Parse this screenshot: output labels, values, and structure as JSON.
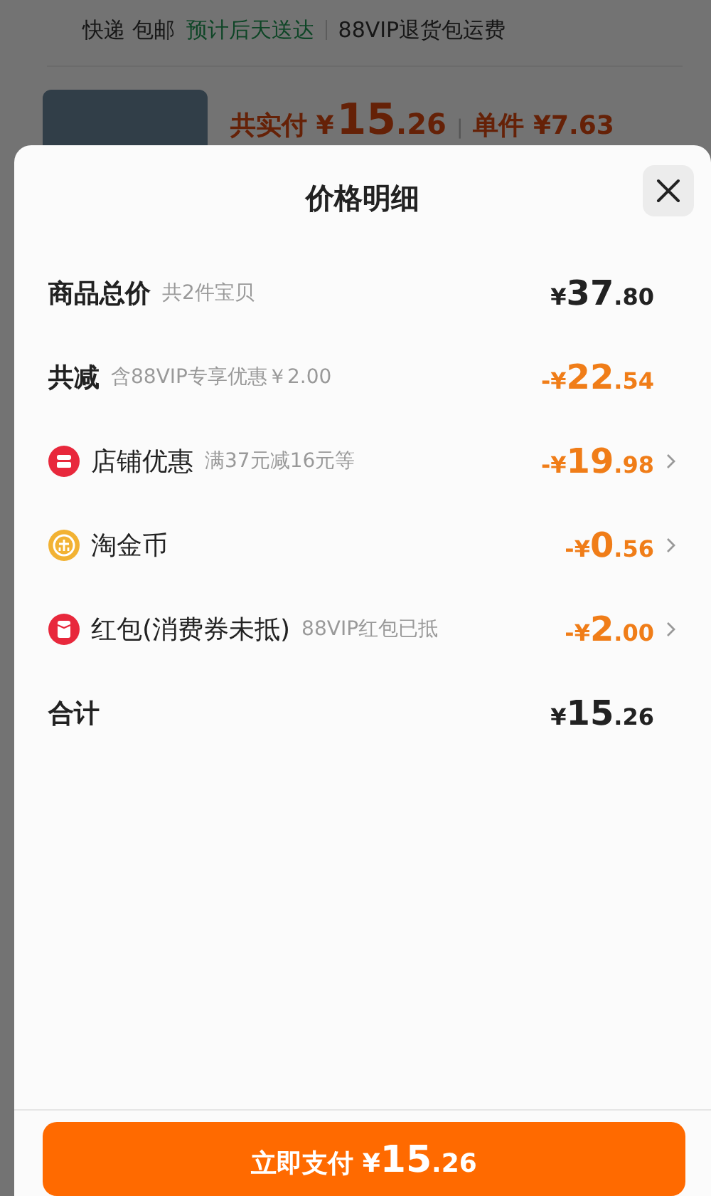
{
  "background_page": {
    "shipping": {
      "method": "快递 包邮",
      "eta": "预计后天送达",
      "service": "88VIP退货包运费"
    },
    "summary": {
      "label": "共实付",
      "currency": "¥",
      "amount_int": "15",
      "amount_dec": ".26",
      "separator": "|",
      "unit_label": "单件 ¥7.63"
    }
  },
  "sheet": {
    "title": "价格明细",
    "rows": [
      {
        "kind": "total",
        "label": "商品总价",
        "note": "共2件宝贝",
        "sign": "¥",
        "amount_int": "37",
        "amount_dec": ".80",
        "chevron": false
      },
      {
        "kind": "discount",
        "label": "共减",
        "note": "含88VIP专享优惠￥2.00",
        "sign": "-¥",
        "amount_int": "22",
        "amount_dec": ".54",
        "chevron": false
      },
      {
        "kind": "discount",
        "label": "店铺优惠",
        "note": "满37元减16元等",
        "sign": "-¥",
        "amount_int": "19",
        "amount_dec": ".98",
        "chevron": true
      },
      {
        "kind": "discount",
        "label": "淘金币",
        "sign": "-¥",
        "amount_int": "0",
        "amount_dec": ".56",
        "chevron": true
      },
      {
        "kind": "discount",
        "label": "红包(消费券未抵)",
        "note": "88VIP红包已抵",
        "sign": "-¥",
        "amount_int": "2",
        "amount_dec": ".00",
        "chevron": true
      },
      {
        "kind": "total",
        "label": "合计",
        "sign": "¥",
        "amount_int": "15",
        "amount_dec": ".26",
        "chevron": false
      }
    ],
    "pay_button": {
      "label": "立即支付",
      "sign": "¥",
      "amount_int": "15",
      "amount_dec": ".26"
    }
  }
}
